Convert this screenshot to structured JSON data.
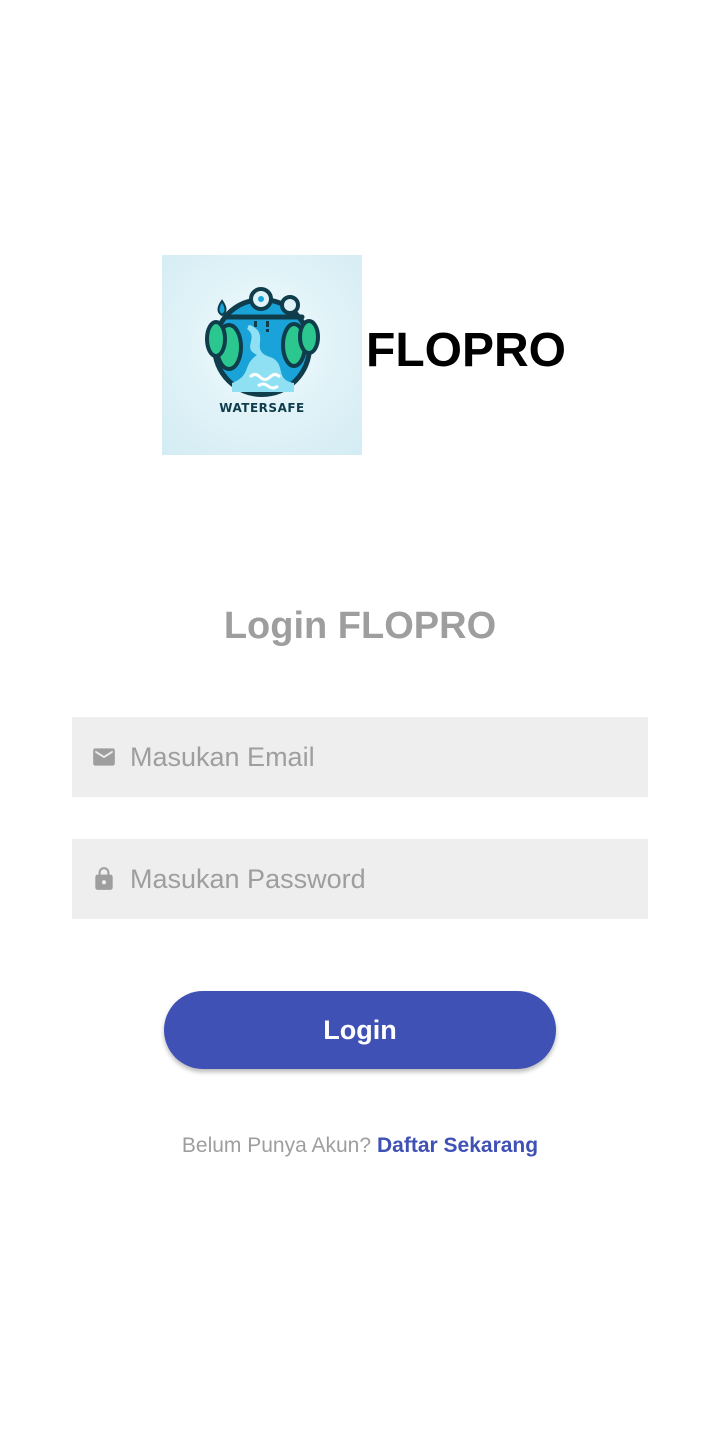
{
  "brand": {
    "logo_label": "WATERSAFE",
    "app_name": "FLOPRO",
    "logo_bg_color": "#dff2f7",
    "logo_primary_color": "#1aa3d9",
    "logo_secondary_color": "#2bc78f"
  },
  "login": {
    "title": "Login FLOPRO",
    "email": {
      "icon": "email-icon",
      "placeholder": "Masukan Email",
      "value": ""
    },
    "password": {
      "icon": "lock-icon",
      "placeholder": "Masukan Password",
      "value": ""
    },
    "submit_label": "Login",
    "signup_prompt": "Belum Punya Akun?",
    "signup_link": "Daftar Sekarang"
  },
  "colors": {
    "accent": "#3f51b5",
    "muted_text": "#9e9e9e",
    "field_bg": "#eeeeee",
    "background": "#ffffff"
  }
}
